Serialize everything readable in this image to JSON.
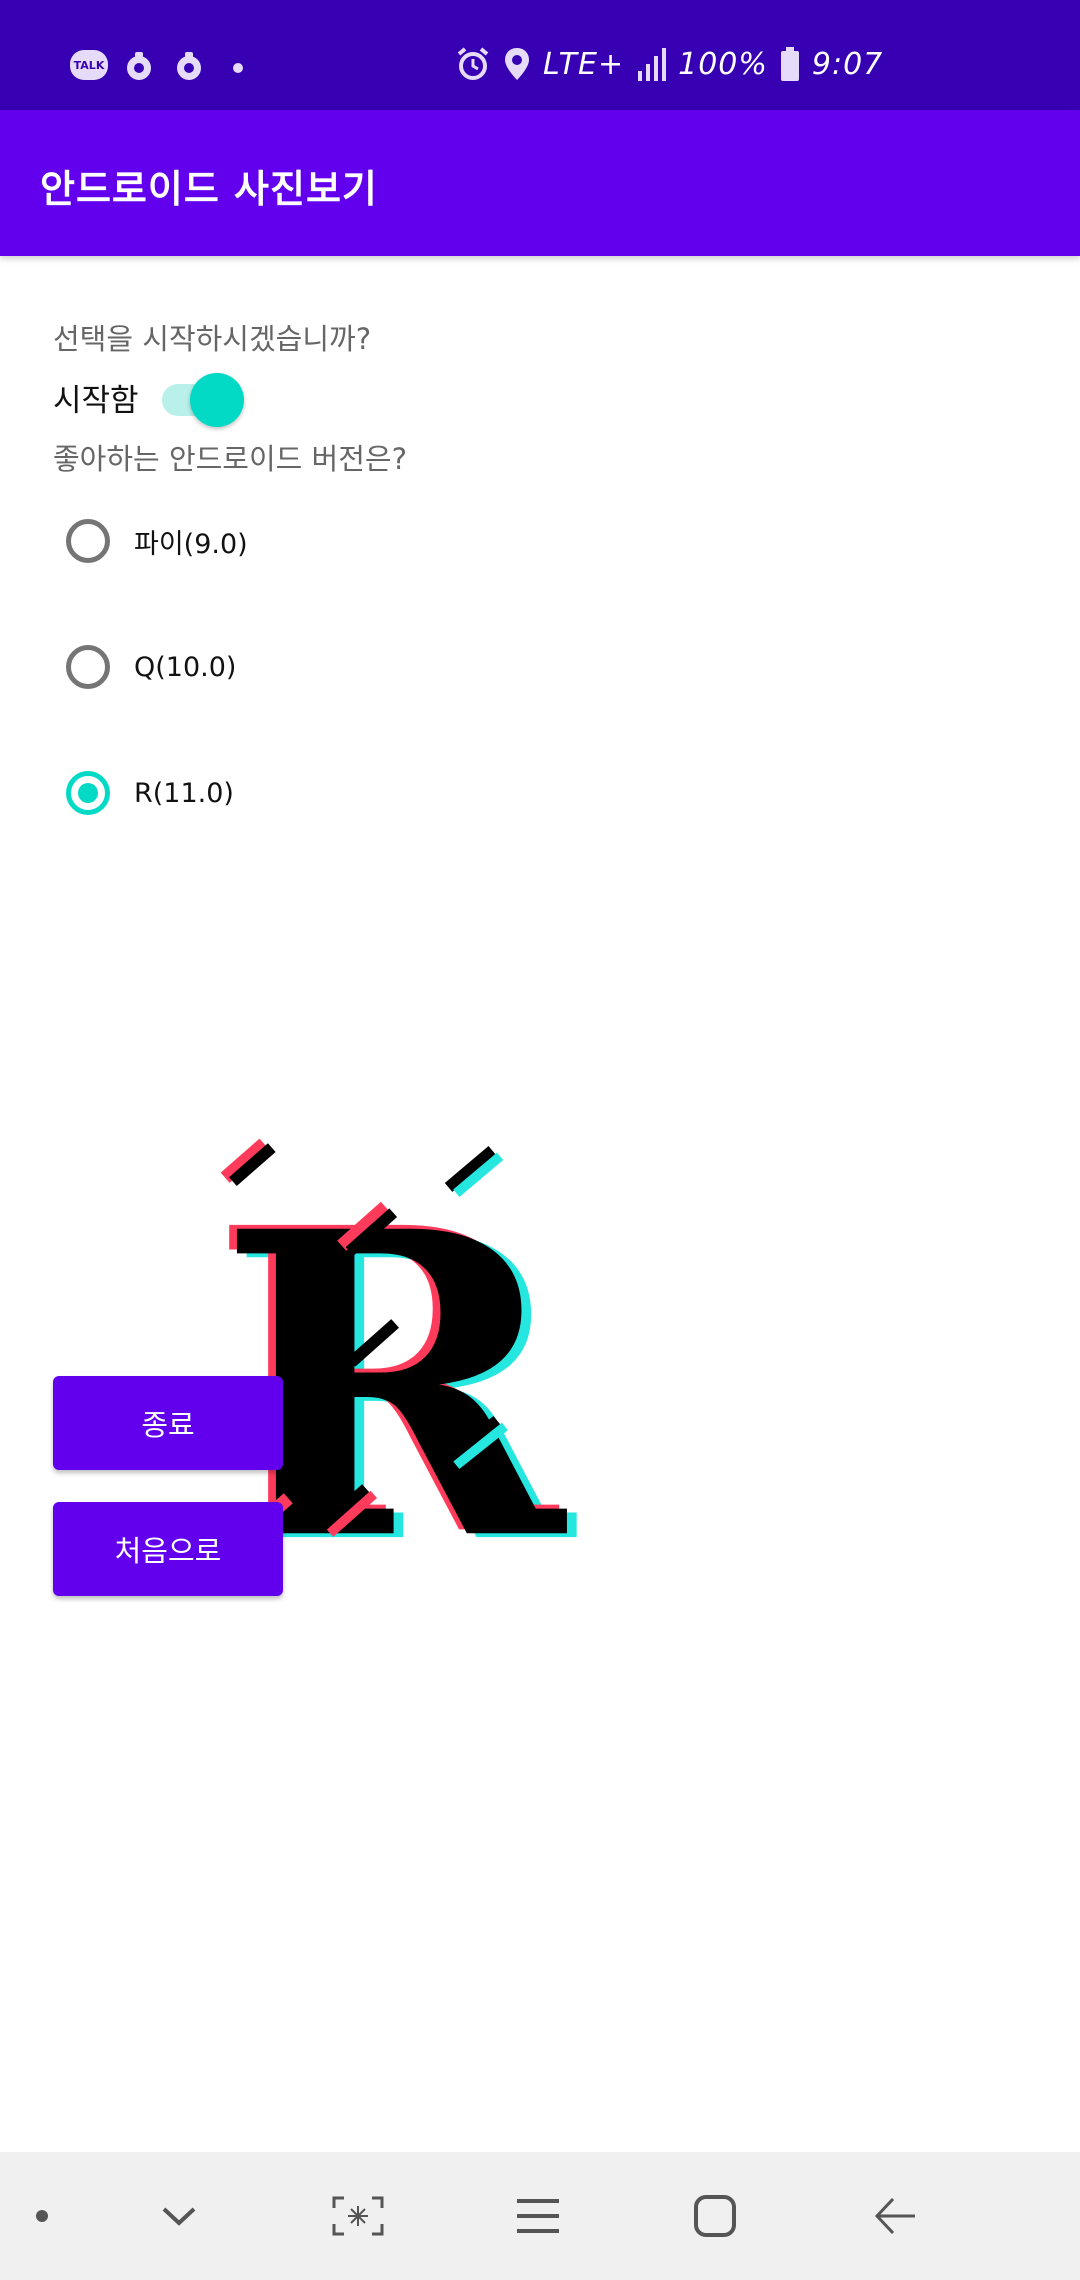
{
  "status_bar": {
    "talk_badge": "TALK",
    "network": "LTE+",
    "battery": "100%",
    "time": "9:07",
    "icons": [
      "talk-icon",
      "app-notification-icon",
      "app-notification-icon",
      "more-dot-icon",
      "alarm-icon",
      "location-icon",
      "lte-icon",
      "signal-icon",
      "battery-icon"
    ]
  },
  "app_bar": {
    "title": "안드로이드 사진보기"
  },
  "main": {
    "question_start": "선택을 시작하시겠습니까?",
    "switch": {
      "label": "시작함",
      "checked": true
    },
    "question_version": "좋아하는 안드로이드 버전은?",
    "radios": [
      {
        "label": "파이(9.0)",
        "checked": false
      },
      {
        "label": "Q(10.0)",
        "checked": false
      },
      {
        "label": "R(11.0)",
        "checked": true
      }
    ],
    "image_letter": "R",
    "buttons": {
      "exit_label": "종료",
      "restart_label": "처음으로"
    }
  },
  "nav_bar": {
    "items": [
      "dot-icon",
      "chevron-down-icon",
      "screenshot-icon",
      "recents-icon",
      "home-icon",
      "back-icon"
    ]
  },
  "colors": {
    "status_bar": "#3700b3",
    "primary": "#6200ee",
    "accent": "#03dac5",
    "glitch_red": "#ff3b5c",
    "glitch_cyan": "#26e6e0"
  }
}
